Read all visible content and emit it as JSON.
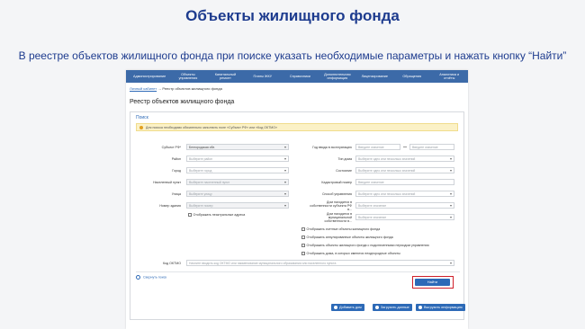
{
  "slide": {
    "title": "Объекты жилищного фонда",
    "subtitle": "В реестре объектов жилищного фонда при поиске указать необходимые параметры и нажать кнопку “Найти”"
  },
  "nav": [
    "Администрирование",
    "Объекты управления",
    "Капитальный ремонт",
    "Платы ЖКУ",
    "Справочники",
    "Дополнительная информация",
    "Лицензирование",
    "Обращения",
    "Аналитика и отчёты"
  ],
  "breadcrumb": {
    "home": "Личный кабинет",
    "sep": "→",
    "current": "Реестр объектов жилищного фонда"
  },
  "page_title": "Реестр объектов жилищного фонда",
  "search": {
    "header": "Поиск",
    "alert": "Для поиска необходимо обязательно заполнить поле «Субъект РФ» или «Код ОКТМО»",
    "left": [
      {
        "label": "Субъект РФ*",
        "value": "Белгородская обл."
      },
      {
        "label": "Район",
        "value": "Выберите район"
      },
      {
        "label": "Город",
        "value": "Выберите город"
      },
      {
        "label": "Населенный пункт",
        "value": "Выберите населенный пункт"
      },
      {
        "label": "Улица",
        "value": "Выберите улицу"
      },
      {
        "label": "Номер здания",
        "value": "Выберите номер"
      }
    ],
    "right": [
      {
        "label": "Год ввода в эксплуатацию",
        "from": "Введите значение",
        "to": "Введите значение"
      },
      {
        "label": "Тип дома",
        "value": "Выберите одно или несколько значений"
      },
      {
        "label": "Состояние",
        "value": "Выберите одно или несколько значений"
      },
      {
        "label": "Кадастровый номер",
        "value": "Введите значение"
      },
      {
        "label": "Способ управления",
        "value": "Выберите одно или несколько значений"
      },
      {
        "label": "Дом находится в собственности субъекта РФ в...",
        "value": "Выберите значение"
      },
      {
        "label": "Дом находится в муниципальной собственности в...",
        "value": "Выберите значение"
      }
    ],
    "include_addresses": "Отображать неактуальные адреса",
    "checkboxes": [
      "Отображать счетные объекты жилищного фонда",
      "Отображать аннулированные объекты жилищного фонда",
      "Отображать объекты жилищного фонда с подключенными периодом управления",
      "Отображать дома, в которых имеются неоднородные объекты"
    ],
    "oktmo_label": "Код ОКТМО",
    "oktmo_placeholder": "Начните вводить код ОКТМО или наименование муниципального образования или населенного пункта",
    "collapse": "Свернуть поиск",
    "find": "Найти"
  },
  "actions": {
    "add": "Добавить дом",
    "upload": "Загрузить данные",
    "export": "Выгрузить информацию"
  }
}
